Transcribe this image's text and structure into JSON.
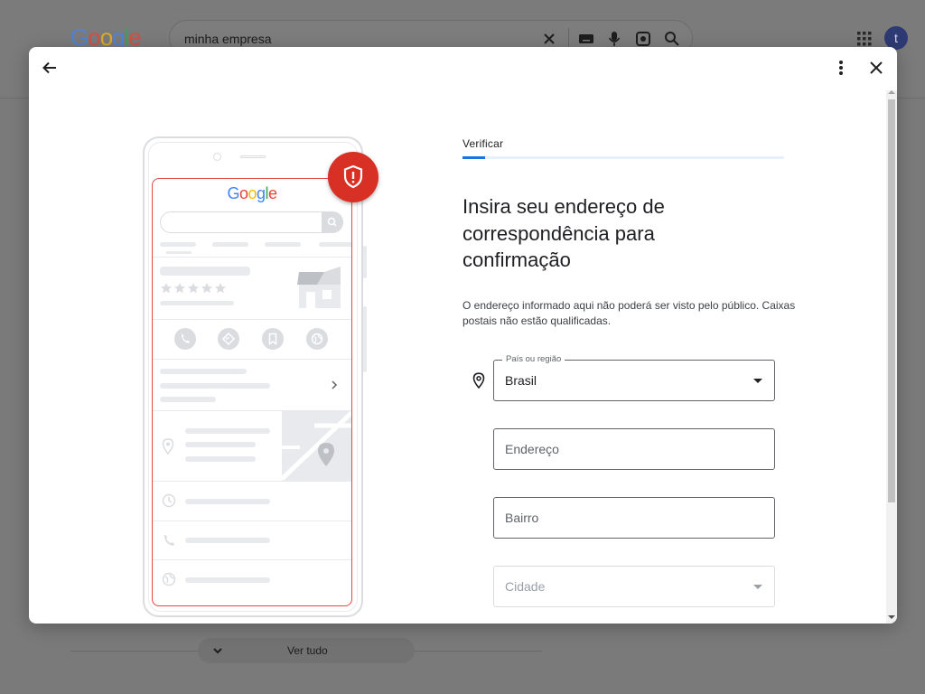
{
  "background": {
    "search_query": "minha empresa",
    "logo_letters": [
      "G",
      "o",
      "o",
      "g",
      "l",
      "e"
    ],
    "logo_colors": [
      "#4285f4",
      "#ea4335",
      "#fbbc05",
      "#4285f4",
      "#34a853",
      "#ea4335"
    ],
    "avatar_letter": "t",
    "see_all_label": "Ver tudo"
  },
  "illustration": {
    "logo_letters": [
      "G",
      "o",
      "o",
      "g",
      "l",
      "e"
    ],
    "logo_colors": [
      "#4285f4",
      "#ea4335",
      "#fbbc05",
      "#4285f4",
      "#34a853",
      "#ea4335"
    ],
    "badge_color": "#d93025"
  },
  "form": {
    "step_label": "Verificar",
    "progress": 0.07,
    "heading": "Insira seu endereço de correspondência para confirmação",
    "description": "O endereço informado aqui não poderá ser visto pelo público. Caixas postais não estão qualificadas.",
    "country": {
      "label": "País ou região",
      "value": "Brasil"
    },
    "address": {
      "placeholder": "Endereço"
    },
    "neighborhood": {
      "placeholder": "Bairro"
    },
    "city": {
      "placeholder": "Cidade"
    }
  },
  "colors": {
    "accent": "#1a73e8",
    "alert": "#d93025"
  }
}
